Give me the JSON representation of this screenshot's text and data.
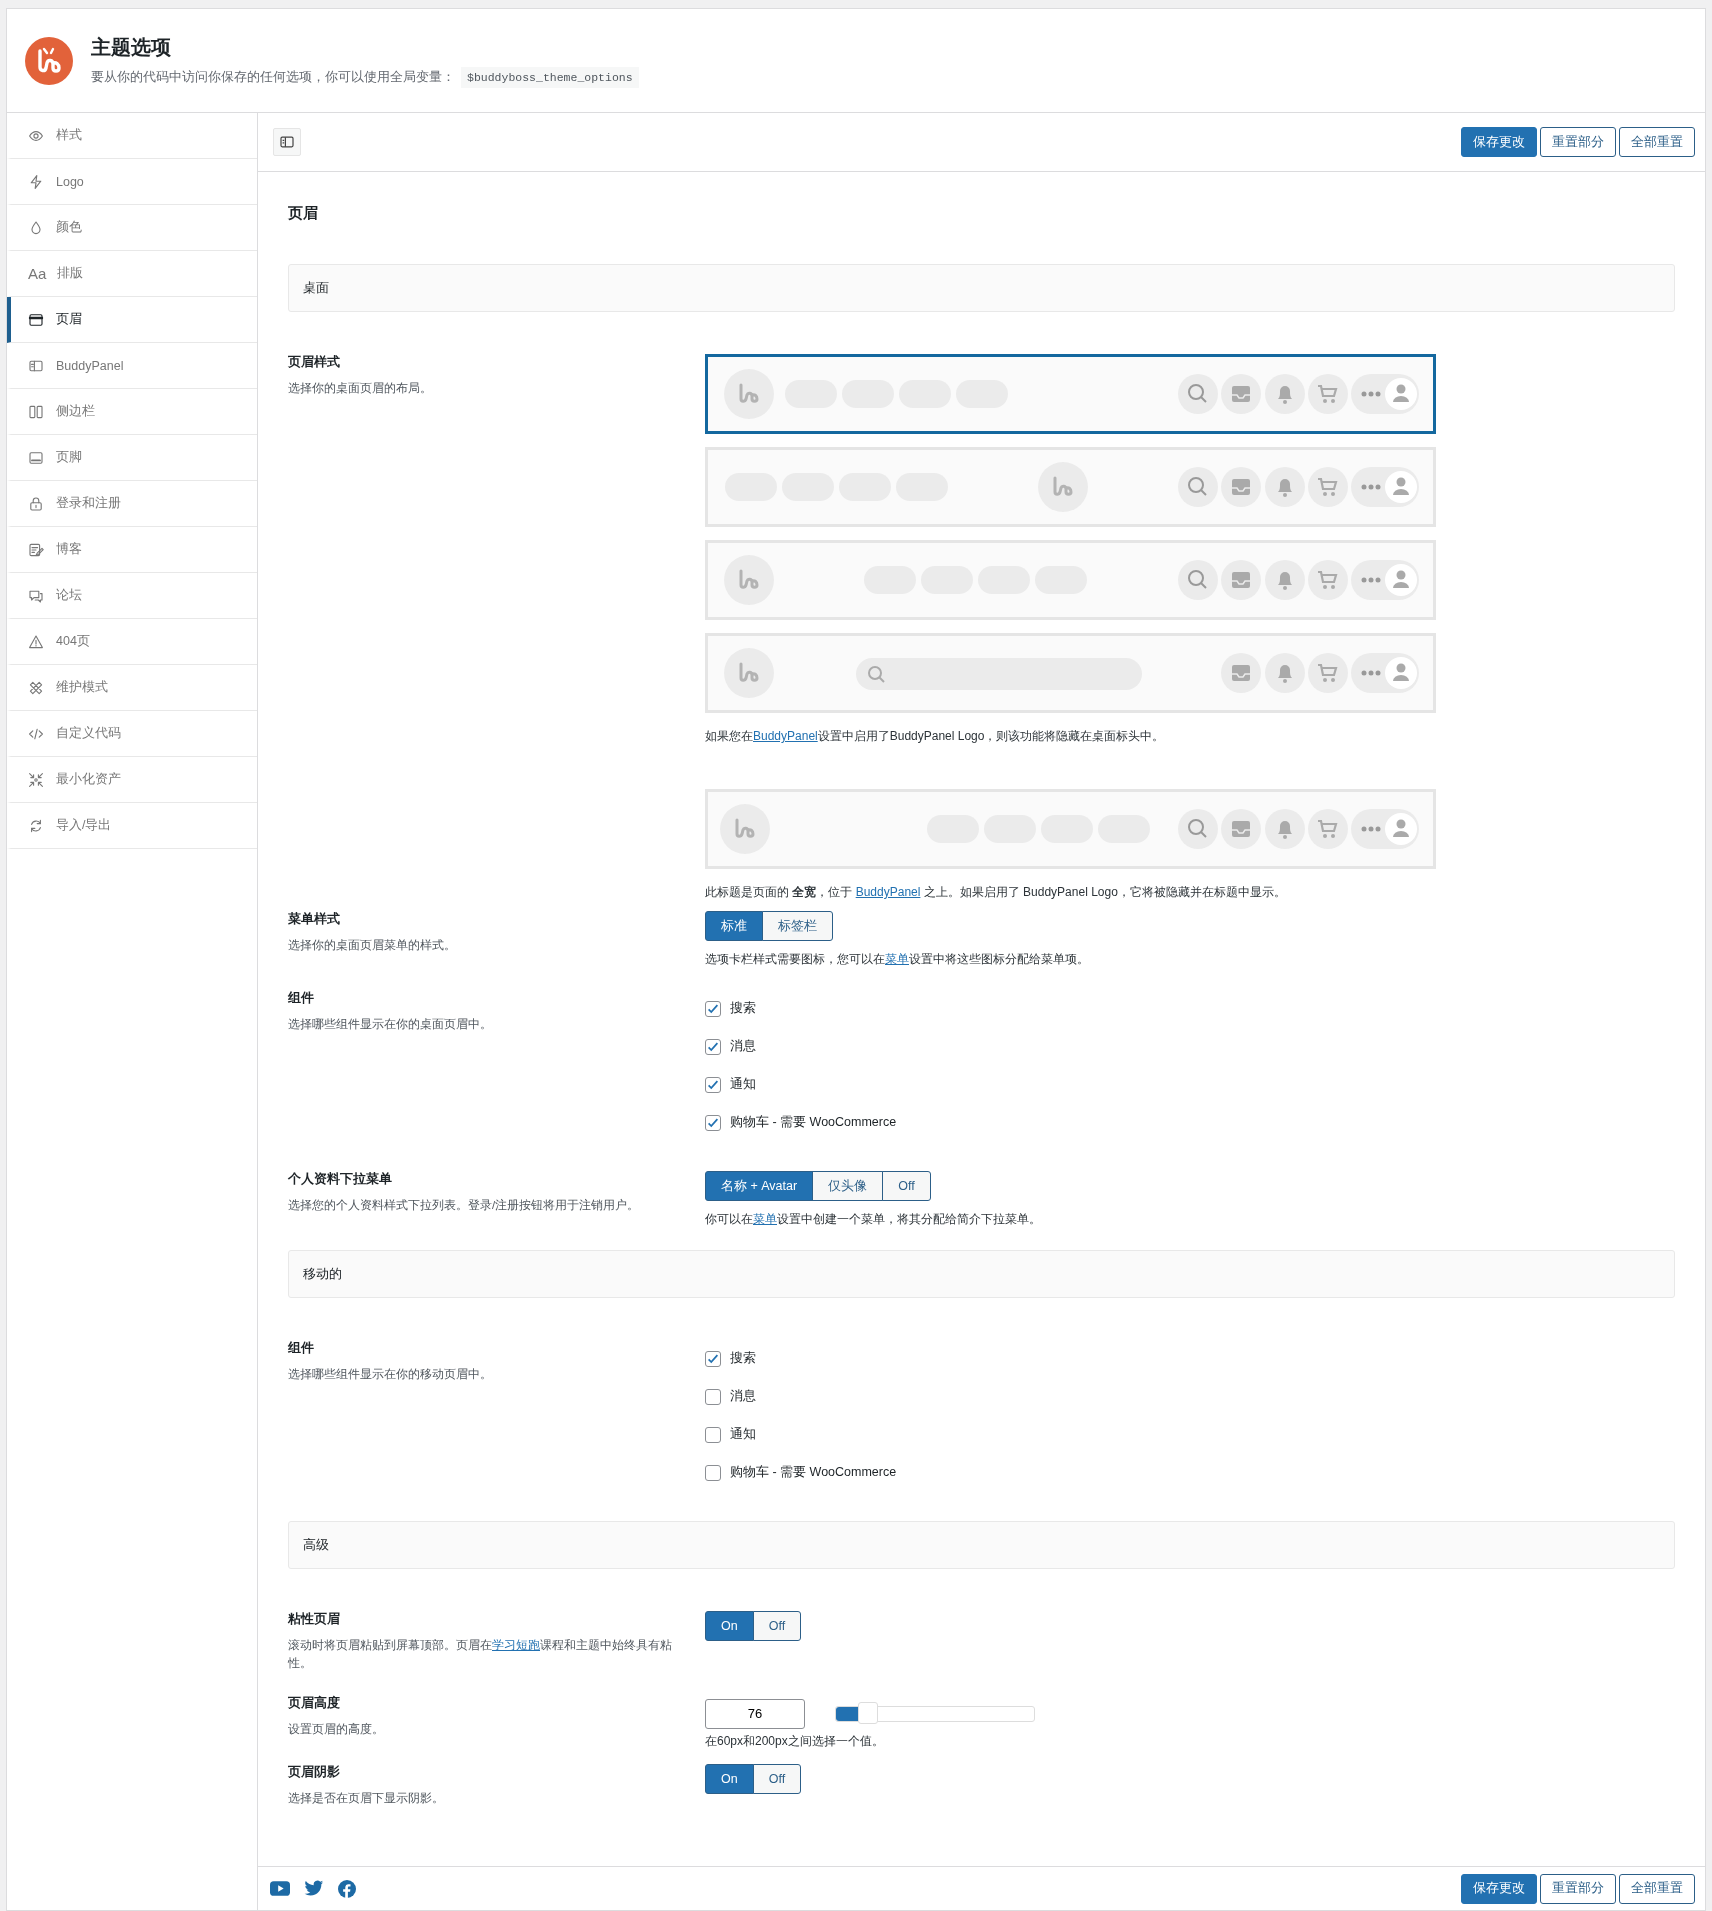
{
  "app": {
    "title": "主题选项",
    "subtitle": "要从你的代码中访问你保存的任何选项，你可以使用全局变量：",
    "variable": "$buddyboss_theme_options"
  },
  "sidebar": {
    "items": [
      {
        "label": "样式",
        "selected": false
      },
      {
        "label": "Logo",
        "selected": false
      },
      {
        "label": "颜色",
        "selected": false
      },
      {
        "label": "排版",
        "selected": false,
        "icon_text": "Aa"
      },
      {
        "label": "页眉",
        "selected": true
      },
      {
        "label": "BuddyPanel",
        "selected": false
      },
      {
        "label": "侧边栏",
        "selected": false
      },
      {
        "label": "页脚",
        "selected": false
      },
      {
        "label": "登录和注册",
        "selected": false
      },
      {
        "label": "博客",
        "selected": false
      },
      {
        "label": "论坛",
        "selected": false
      },
      {
        "label": "404页",
        "selected": false
      },
      {
        "label": "维护模式",
        "selected": false
      },
      {
        "label": "自定义代码",
        "selected": false
      },
      {
        "label": "最小化资产",
        "selected": false
      },
      {
        "label": "导入/导出",
        "selected": false
      }
    ]
  },
  "toolbar": {
    "buttons": [
      {
        "label": "保存更改",
        "kind": "primary"
      },
      {
        "label": "重置部分",
        "kind": "secondary"
      },
      {
        "label": "全部重置",
        "kind": "secondary"
      }
    ]
  },
  "footer": {
    "buttons": [
      {
        "label": "保存更改",
        "kind": "primary"
      },
      {
        "label": "重置部分",
        "kind": "secondary"
      },
      {
        "label": "全部重置",
        "kind": "secondary"
      }
    ]
  },
  "section": {
    "title": "页眉"
  },
  "groups": [
    {
      "heading": "桌面",
      "rows": [
        {
          "kind": "layouts",
          "label": "页眉样式",
          "description": "选择你的桌面页眉的布局。",
          "options": [
            {
              "kind": "logo-left",
              "selected": true
            },
            {
              "kind": "logo-center",
              "selected": false
            },
            {
              "kind": "menu-center",
              "selected": false
            },
            {
              "kind": "search",
              "selected": false
            }
          ],
          "note": [
            {
              "text": "如果您在"
            },
            {
              "text": "BuddyPanel",
              "link": true
            },
            {
              "text": "设置中启用了BuddyPanel Logo，则该功能将隐藏在桌面标头中。"
            }
          ]
        },
        {
          "kind": "layouts",
          "options": [
            {
              "kind": "menu-right",
              "selected": false
            }
          ],
          "note": [
            {
              "text": "此标题是页面的 **全宽**，位于 "
            },
            {
              "text": "BuddyPanel",
              "link": true
            },
            {
              "text": " 之上。如果启用了 BuddyPanel Logo，它将被隐藏并在标题中显示。"
            }
          ]
        },
        {
          "kind": "segmented",
          "label": "菜单样式",
          "description": "选择你的桌面页眉菜单的样式。",
          "options": [
            {
              "label": "标准",
              "selected": true
            },
            {
              "label": "标签栏",
              "selected": false
            }
          ],
          "note": [
            {
              "text": "选项卡栏样式需要图标，您可以在"
            },
            {
              "text": "菜单",
              "link": true
            },
            {
              "text": "设置中将这些图标分配给菜单项。"
            }
          ]
        },
        {
          "kind": "checkboxes",
          "label": "组件",
          "description": "选择哪些组件显示在你的桌面页眉中。",
          "items": [
            {
              "label": "搜索",
              "checked": true
            },
            {
              "label": "消息",
              "checked": true
            },
            {
              "label": "通知",
              "checked": true
            },
            {
              "label": "购物车 - 需要 WooCommerce",
              "checked": true
            }
          ]
        },
        {
          "kind": "segmented",
          "label": "个人资料下拉菜单",
          "description": "选择您的个人资料样式下拉列表。登录/注册按钮将用于注销用户。",
          "options": [
            {
              "label": "名称 + Avatar",
              "selected": true
            },
            {
              "label": "仅头像",
              "selected": false
            },
            {
              "label": "Off",
              "selected": false
            }
          ],
          "note": [
            {
              "text": "你可以在"
            },
            {
              "text": "菜单",
              "link": true
            },
            {
              "text": "设置中创建一个菜单，将其分配给简介下拉菜单。"
            }
          ]
        }
      ]
    },
    {
      "heading": "移动的",
      "rows": [
        {
          "kind": "checkboxes",
          "label": "组件",
          "description": "选择哪些组件显示在你的移动页眉中。",
          "items": [
            {
              "label": "搜索",
              "checked": true
            },
            {
              "label": "消息",
              "checked": false
            },
            {
              "label": "通知",
              "checked": false
            },
            {
              "label": "购物车 - 需要 WooCommerce",
              "checked": false
            }
          ]
        }
      ]
    },
    {
      "heading": "高级",
      "rows": [
        {
          "kind": "segmented",
          "label": "粘性页眉",
          "description_parts": [
            {
              "text": "滚动时将页眉粘贴到屏幕顶部。页眉在"
            },
            {
              "text": "学习短跑",
              "link": true
            },
            {
              "text": "课程和主题中始终具有粘性。"
            }
          ],
          "options": [
            {
              "label": "On",
              "selected": true
            },
            {
              "label": "Off",
              "selected": false
            }
          ]
        },
        {
          "kind": "number-slider",
          "label": "页眉高度",
          "description": "设置页眉的高度。",
          "value": "76",
          "level": 0.11,
          "note": [
            {
              "text": "在60px和200px之间选择一个值。"
            }
          ]
        },
        {
          "kind": "segmented",
          "label": "页眉阴影",
          "description": "选择是否在页眉下显示阴影。",
          "options": [
            {
              "label": "On",
              "selected": true
            },
            {
              "label": "Off",
              "selected": false
            }
          ]
        }
      ]
    }
  ]
}
